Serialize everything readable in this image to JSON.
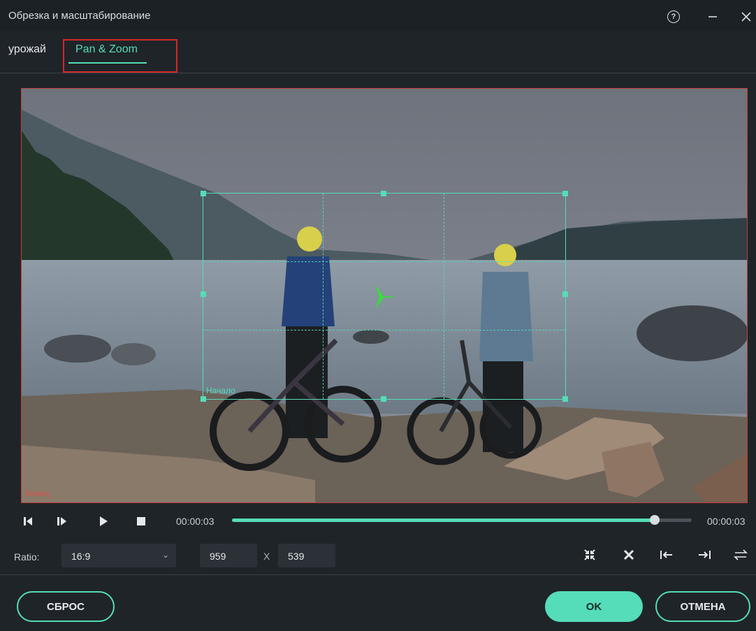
{
  "window": {
    "title": "Обрезка и масштабирование",
    "help_icon": "help-circle-icon",
    "minimize_icon": "minimize-icon",
    "close_icon": "close-icon"
  },
  "tabs": [
    {
      "label": "урожай",
      "active": false
    },
    {
      "label": "Pan & Zoom",
      "active": true
    }
  ],
  "preview": {
    "end_label": "Конец",
    "start_label": "Начало",
    "center_marker_icon": "green-arrow-icon"
  },
  "playback": {
    "prev_frame_icon": "previous-frame-icon",
    "next_frame_icon": "next-frame-icon",
    "play_icon": "play-icon",
    "stop_icon": "stop-icon",
    "current_time": "00:00:03",
    "total_time": "00:00:03",
    "progress": 0.92
  },
  "ratio": {
    "label": "Ratio:",
    "selected": "16:9",
    "width": "959",
    "separator": "X",
    "height": "539",
    "tools": [
      "fit-icon",
      "cross-icon",
      "align-start-icon",
      "align-end-icon",
      "swap-icon"
    ]
  },
  "buttons": {
    "reset": "СБРОС",
    "ok": "OK",
    "cancel": "ОТМЕНА"
  },
  "colors": {
    "accent": "#55dcb8",
    "highlight_box": "#d62828",
    "end_frame": "#e0504a",
    "background": "#1f2429"
  }
}
